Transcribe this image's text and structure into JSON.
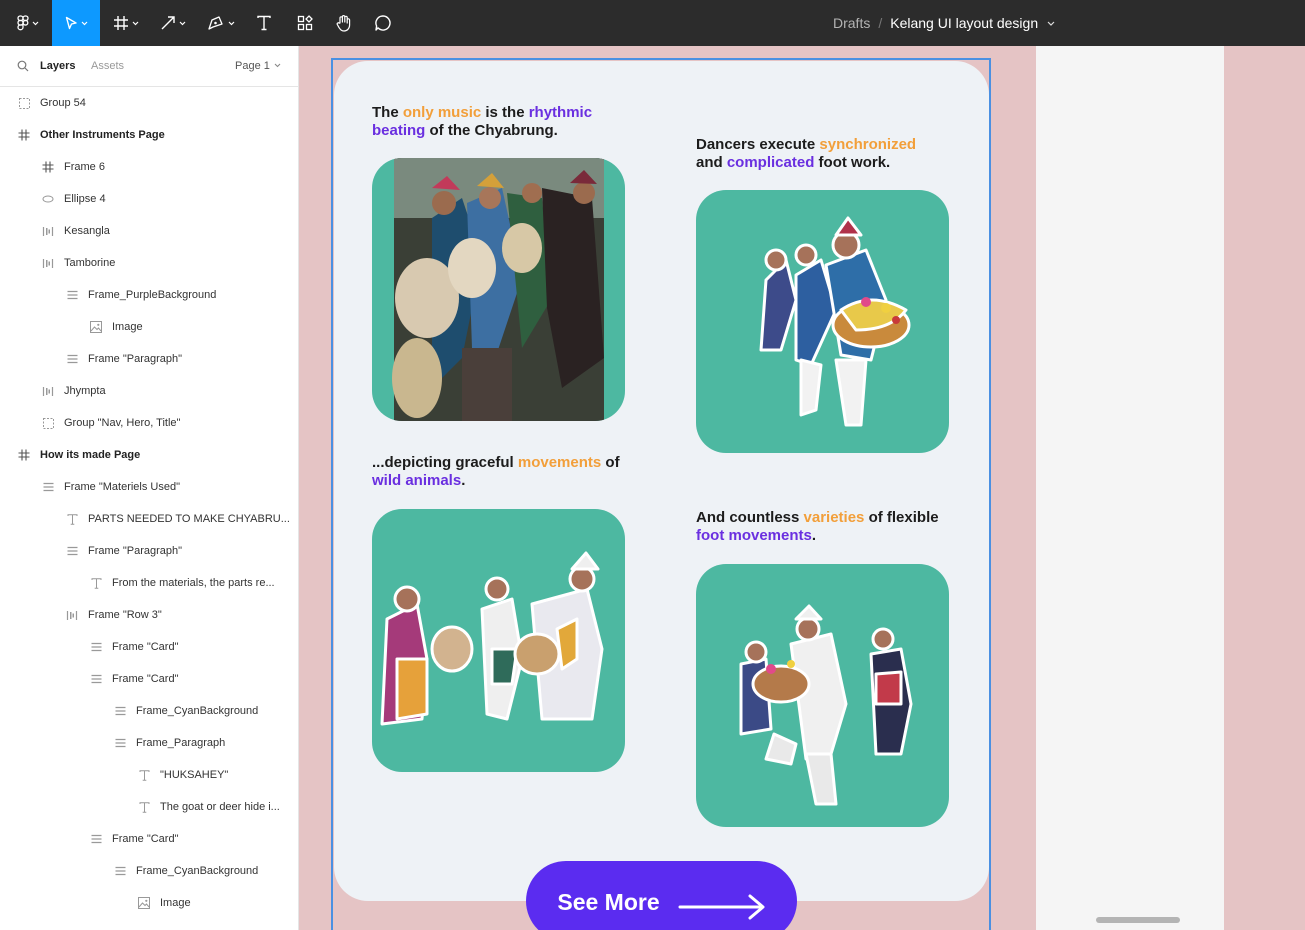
{
  "toolbar": {
    "tools": [
      {
        "name": "main-menu",
        "icon": "figma-logo-icon"
      },
      {
        "name": "move-tool",
        "icon": "cursor-icon",
        "active": true
      },
      {
        "name": "frame-tool",
        "icon": "frame-icon"
      },
      {
        "name": "shape-tool",
        "icon": "arrow-line-icon"
      },
      {
        "name": "pen-tool",
        "icon": "pen-icon"
      },
      {
        "name": "text-tool",
        "icon": "text-icon"
      },
      {
        "name": "resources-tool",
        "icon": "components-icon"
      },
      {
        "name": "hand-tool",
        "icon": "hand-icon"
      },
      {
        "name": "comment-tool",
        "icon": "comment-icon"
      }
    ],
    "breadcrumb": {
      "location": "Drafts",
      "separator": "/",
      "file_name": "Kelang UI layout design"
    }
  },
  "layers_panel": {
    "tabs": {
      "layers": "Layers",
      "assets": "Assets",
      "page": "Page 1"
    },
    "items": [
      {
        "label": "Group 54",
        "icon": "group-icon",
        "indent": 0
      },
      {
        "label": "Other Instruments Page",
        "icon": "frame-icon",
        "indent": 0,
        "top": true
      },
      {
        "label": "Frame 6",
        "icon": "frame-icon",
        "indent": 1
      },
      {
        "label": "Ellipse 4",
        "icon": "ellipse-icon",
        "indent": 1
      },
      {
        "label": "Kesangla",
        "icon": "auto-layout-horizontal-icon",
        "indent": 1
      },
      {
        "label": "Tamborine",
        "icon": "auto-layout-horizontal-icon",
        "indent": 1
      },
      {
        "label": "Frame_PurpleBackground",
        "icon": "auto-layout-vertical-icon",
        "indent": 2
      },
      {
        "label": "Image",
        "icon": "image-icon",
        "indent": 3
      },
      {
        "label": "Frame \"Paragraph\"",
        "icon": "auto-layout-vertical-icon",
        "indent": 2
      },
      {
        "label": "Jhympta",
        "icon": "auto-layout-horizontal-icon",
        "indent": 1
      },
      {
        "label": "Group \"Nav, Hero, Title\"",
        "icon": "group-icon",
        "indent": 1
      },
      {
        "label": "How its made Page",
        "icon": "frame-icon",
        "indent": 0,
        "top": true
      },
      {
        "label": "Frame \"Materiels Used\"",
        "icon": "auto-layout-vertical-icon",
        "indent": 1
      },
      {
        "label": "PARTS NEEDED TO MAKE CHYABRU...",
        "icon": "text-icon",
        "indent": 2
      },
      {
        "label": "Frame \"Paragraph\"",
        "icon": "auto-layout-vertical-icon",
        "indent": 2
      },
      {
        "label": "From the materials, the parts re...",
        "icon": "text-icon",
        "indent": 3
      },
      {
        "label": "Frame \"Row 3\"",
        "icon": "auto-layout-horizontal-icon",
        "indent": 2
      },
      {
        "label": "Frame \"Card\"",
        "icon": "auto-layout-vertical-icon",
        "indent": 3
      },
      {
        "label": "Frame \"Card\"",
        "icon": "auto-layout-vertical-icon",
        "indent": 3
      },
      {
        "label": "Frame_CyanBackground",
        "icon": "auto-layout-vertical-icon",
        "indent": 4
      },
      {
        "label": "Frame_Paragraph",
        "icon": "auto-layout-vertical-icon",
        "indent": 4
      },
      {
        "label": "\"HUKSAHEY\"",
        "icon": "text-icon",
        "indent": 5
      },
      {
        "label": "The goat or deer hide i...",
        "icon": "text-icon",
        "indent": 5
      },
      {
        "label": "Frame \"Card\"",
        "icon": "auto-layout-vertical-icon",
        "indent": 3
      },
      {
        "label": "Frame_CyanBackground",
        "icon": "auto-layout-vertical-icon",
        "indent": 4
      },
      {
        "label": "Image",
        "icon": "image-icon",
        "indent": 5
      }
    ]
  },
  "canvas": {
    "captions": [
      [
        {
          "t": "The "
        },
        {
          "t": "only music",
          "c": "orange"
        },
        {
          "t": " is the "
        },
        {
          "t": "rhythmic beating",
          "c": "purple"
        },
        {
          "t": " of the Chyabrung."
        }
      ],
      [
        {
          "t": "Dancers execute "
        },
        {
          "t": "synchronized",
          "c": "orange"
        },
        {
          "t": " and "
        },
        {
          "t": "complicated",
          "c": "purple"
        },
        {
          "t": " foot work."
        }
      ],
      [
        {
          "t": "...depicting graceful "
        },
        {
          "t": "movements",
          "c": "orange"
        },
        {
          "t": " of "
        },
        {
          "t": "wild animals",
          "c": "purple"
        },
        {
          "t": "."
        }
      ],
      [
        {
          "t": "And countless "
        },
        {
          "t": "varieties",
          "c": "orange"
        },
        {
          "t": " of flexible "
        },
        {
          "t": "foot movements",
          "c": "purple"
        },
        {
          "t": "."
        }
      ]
    ],
    "cards": [
      {
        "image": "drummers-photo"
      },
      {
        "image": "dancers-with-drum"
      },
      {
        "image": "dancers-group"
      },
      {
        "image": "couple-dancing"
      }
    ],
    "see_more": {
      "label": "See More",
      "icon": "long-arrow-right-icon"
    }
  },
  "colors": {
    "accent_orange": "#f29f3a",
    "accent_purple": "#6a2fe0",
    "card_teal": "#4db8a1",
    "button_purple": "#5b2cf0",
    "selection_blue": "#4a90e2"
  }
}
